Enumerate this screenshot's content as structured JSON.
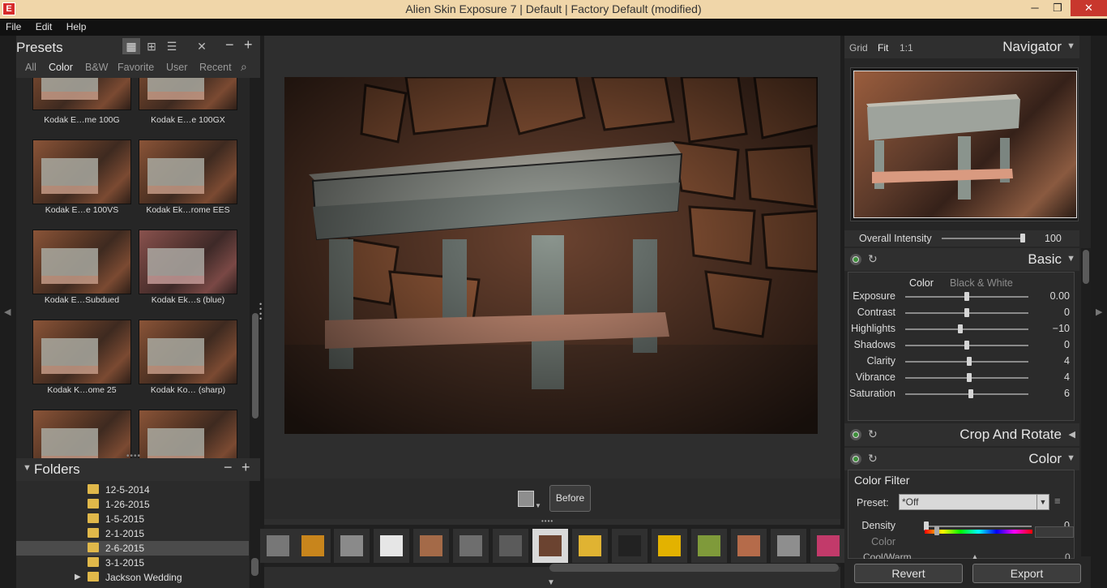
{
  "window": {
    "title": "Alien Skin Exposure 7 | Default | Factory Default (modified)",
    "icon": "app-icon",
    "minimize": "─",
    "maximize": "❐",
    "close": "✕"
  },
  "menu": [
    "File",
    "Edit",
    "Help"
  ],
  "presets": {
    "title": "Presets",
    "minus": "−",
    "plus": "+",
    "tabs": [
      "All",
      "Color",
      "B&W",
      "Favorite",
      "User",
      "Recent"
    ],
    "active_tab": "Color",
    "items": [
      "Kodak E…me 100G",
      "Kodak E…e 100GX",
      "Kodak E…e 100VS",
      "Kodak Ek…rome EES",
      "Kodak E…Subdued",
      "Kodak Ek…s (blue)",
      "Kodak K…ome 25",
      "Kodak Ko… (sharp)"
    ]
  },
  "folders": {
    "title": "Folders",
    "minus": "−",
    "plus": "+",
    "items": [
      "12-5-2014",
      "1-26-2015",
      "1-5-2015",
      "2-1-2015",
      "2-6-2015",
      "3-1-2015",
      "Jackson Wedding"
    ],
    "selected": "2-6-2015"
  },
  "center": {
    "before_label": "Before"
  },
  "navigator": {
    "zoom_options": [
      "Grid",
      "Fit",
      "1:1"
    ],
    "active_zoom": "Fit",
    "title": "Navigator"
  },
  "overall_intensity": {
    "label": "Overall Intensity",
    "value": "100",
    "fraction": 1.0
  },
  "basic": {
    "title": "Basic",
    "tabs": [
      "Color",
      "Black & White"
    ],
    "sliders": [
      {
        "label": "Exposure",
        "value": "0.00",
        "fraction": 0.5
      },
      {
        "label": "Contrast",
        "value": "0",
        "fraction": 0.5
      },
      {
        "label": "Highlights",
        "value": "−10",
        "fraction": 0.45
      },
      {
        "label": "Shadows",
        "value": "0",
        "fraction": 0.5
      },
      {
        "label": "Clarity",
        "value": "4",
        "fraction": 0.52
      },
      {
        "label": "Vibrance",
        "value": "4",
        "fraction": 0.52
      },
      {
        "label": "Saturation",
        "value": "6",
        "fraction": 0.53
      }
    ]
  },
  "crop": {
    "title": "Crop And Rotate"
  },
  "color": {
    "title": "Color",
    "filter_title": "Color Filter",
    "preset_label": "Preset:",
    "preset_value": "*Off",
    "density": {
      "label": "Density",
      "value": "0",
      "fraction": 0.0
    },
    "color_label": "Color",
    "cool_warm": {
      "label": "Cool/Warm",
      "value": "0"
    }
  },
  "footer": {
    "revert": "Revert",
    "export": "Export"
  }
}
